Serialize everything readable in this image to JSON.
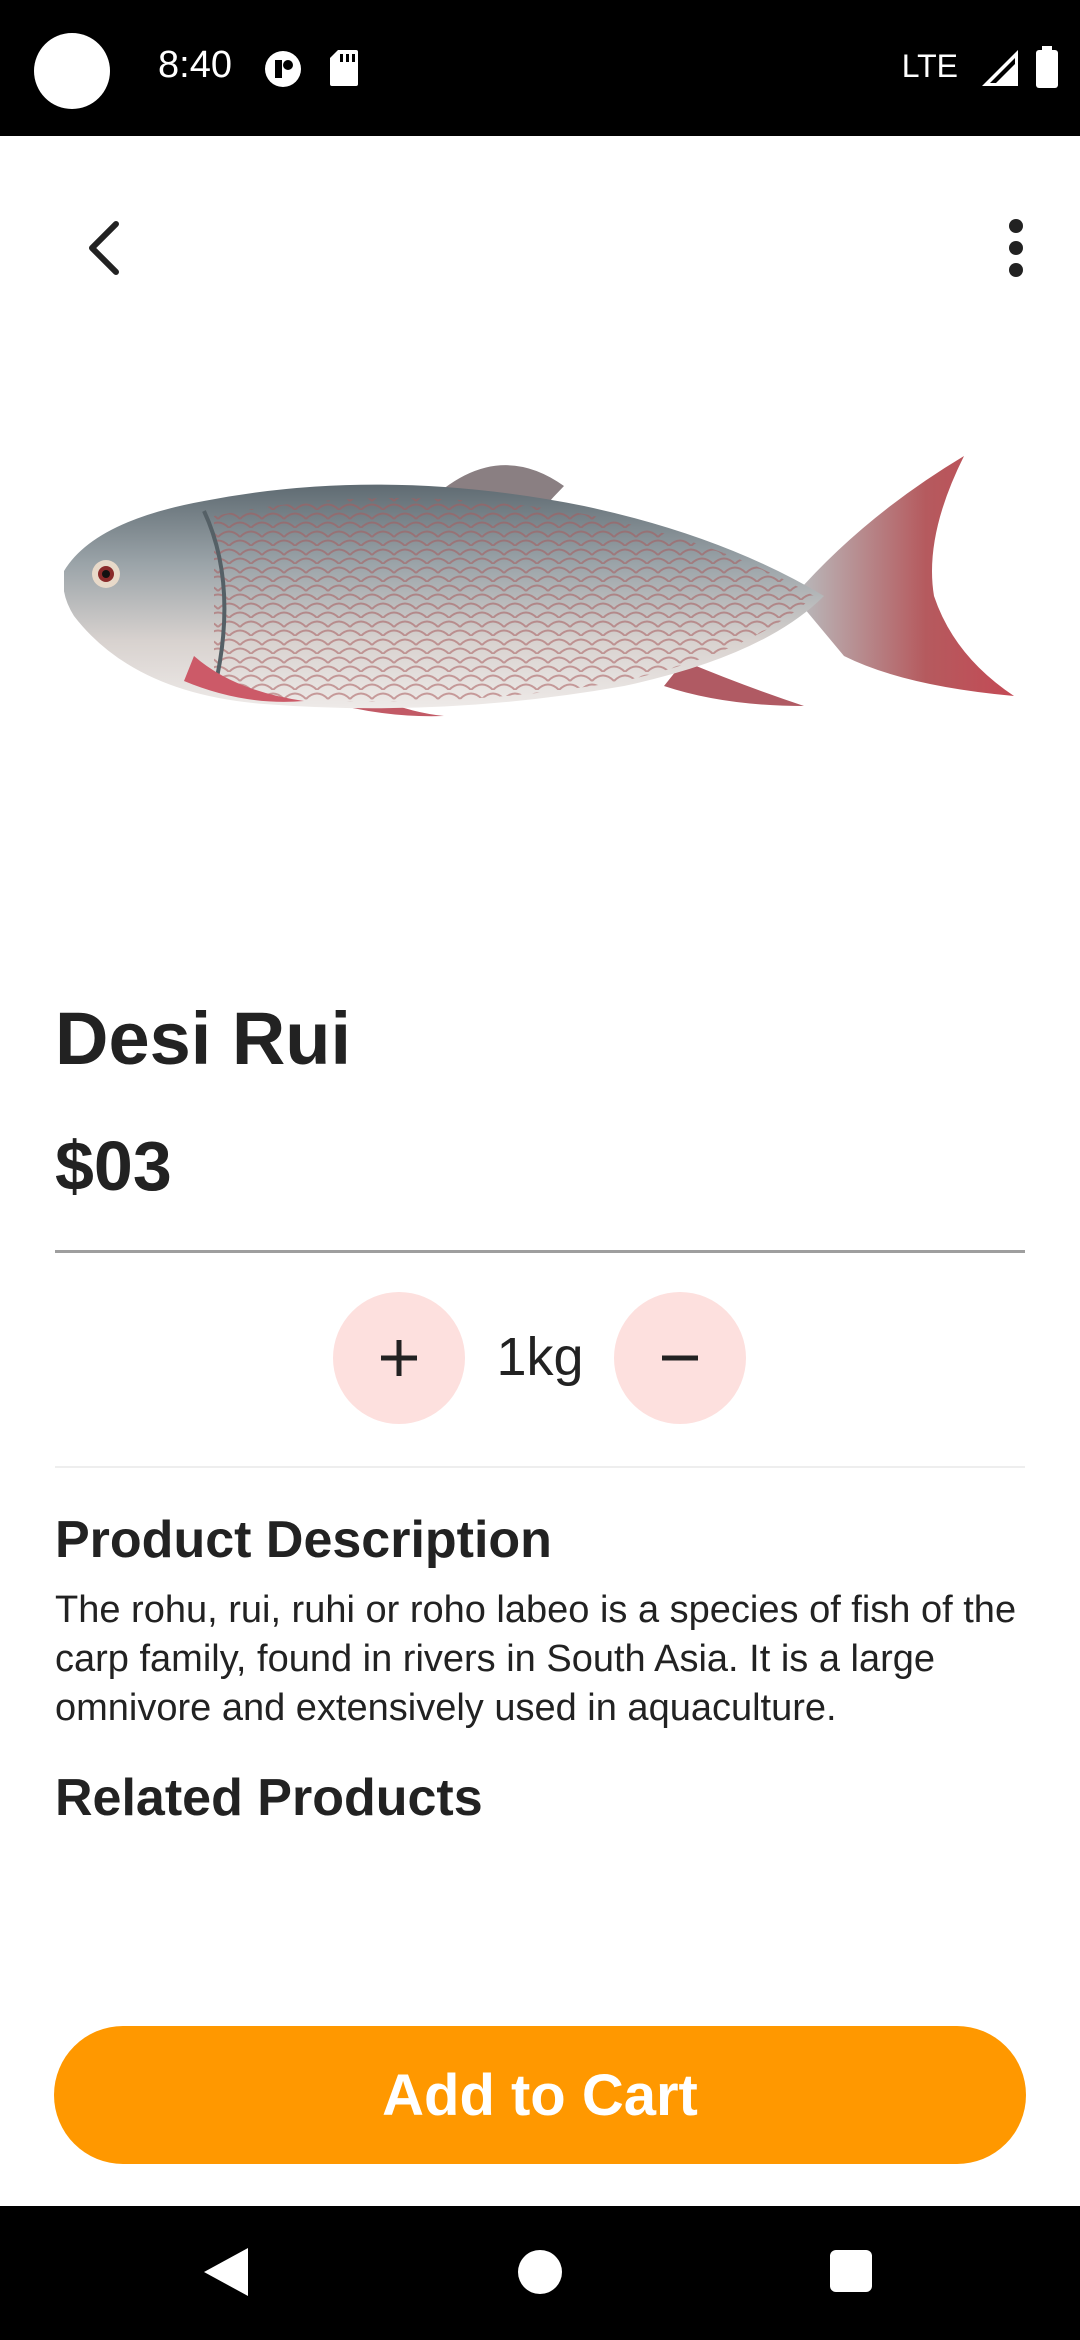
{
  "status_bar": {
    "time": "8:40",
    "network": "LTE"
  },
  "toolbar": {
    "back_icon": "arrow-back-icon",
    "more_icon": "more-vert-icon"
  },
  "product": {
    "title": "Desi Rui",
    "price": "$03",
    "image": "fish-image"
  },
  "quantity": {
    "value": "1kg",
    "increase_icon": "plus-icon",
    "decrease_icon": "minus-icon"
  },
  "description": {
    "heading": "Product Description",
    "text": "The rohu, rui, ruhi or roho labeo is a species of fish of the carp family, found in rivers in South Asia. It is a large omnivore and extensively used in aquaculture."
  },
  "related": {
    "heading": "Related Products"
  },
  "actions": {
    "add_to_cart_label": "Add to Cart"
  },
  "colors": {
    "accent": "#ff9800",
    "qty_button_bg": "#fde0de",
    "text": "#222222"
  }
}
